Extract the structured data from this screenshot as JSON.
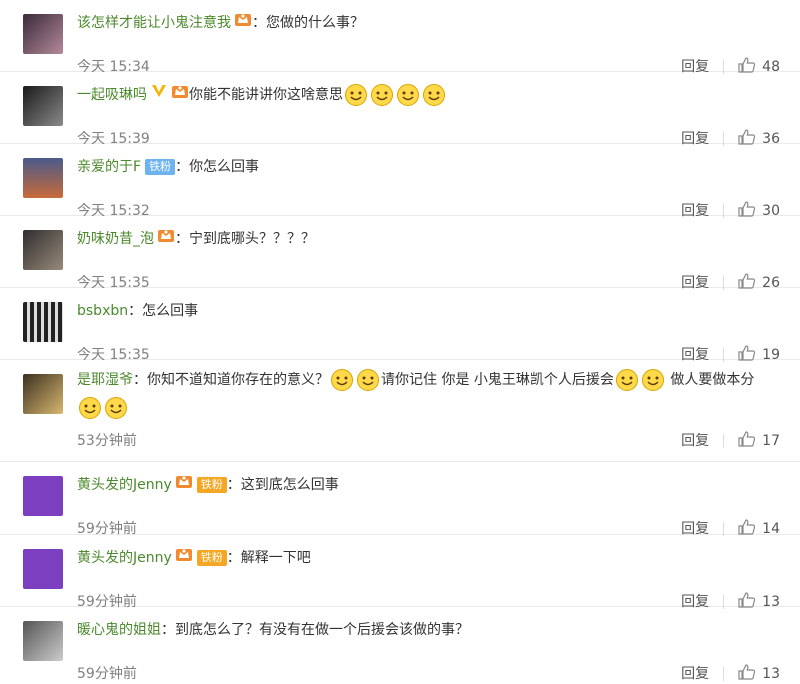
{
  "comments": [
    {
      "user": "该怎样才能让小鬼注意我",
      "badges": [
        "vip"
      ],
      "sep": "：",
      "text": "您做的什么事？",
      "smileys": 0,
      "time": "今天 15:34",
      "reply": "回复",
      "likes": "48"
    },
    {
      "user": "一起吸琳吗",
      "badges": [
        "verified",
        "vip"
      ],
      "sep": "",
      "text": "你能不能讲讲你这啥意思",
      "smileys": 4,
      "time": "今天 15:39",
      "reply": "回复",
      "likes": "36"
    },
    {
      "user": "亲爱的于F",
      "fan": "铁粉",
      "fan_color": "#6db3f0",
      "sep": "：",
      "text": "你怎么回事",
      "smileys": 0,
      "time": "今天 15:32",
      "reply": "回复",
      "likes": "30"
    },
    {
      "user": "奶味奶昔_泡",
      "badges": [
        "vip"
      ],
      "sep": "：",
      "text": "宁到底哪头？？？？",
      "smileys": 0,
      "time": "今天 15:35",
      "reply": "回复",
      "likes": "26"
    },
    {
      "user": "bsbxbn",
      "sep": "：",
      "text": "怎么回事",
      "smileys": 0,
      "time": "今天 15:35",
      "reply": "回复",
      "likes": "19"
    },
    {
      "user": "是耶湿爷",
      "sep": "：",
      "text_parts": [
        "你知不道知道你存在的意义？",
        "请你记住 你是 小鬼王琳凯个人后援会",
        "做人要做本分"
      ],
      "time": "53分钟前",
      "reply": "回复",
      "likes": "17"
    },
    {
      "user": "黄头发的Jenny",
      "fan": "铁粉",
      "fan_color": "#f5a623",
      "sep": "：",
      "text": "这到底怎么回事",
      "smileys": 0,
      "time": "59分钟前",
      "reply": "回复",
      "likes": "14"
    },
    {
      "user": "黄头发的Jenny",
      "fan": "铁粉",
      "fan_color": "#f5a623",
      "sep": "：",
      "text": "解释一下吧",
      "smileys": 0,
      "time": "59分钟前",
      "reply": "回复",
      "likes": "13"
    },
    {
      "user": "暖心鬼的姐姐",
      "sep": "：",
      "text": "到底怎么了？有没有在做一个后援会该做的事？",
      "smileys": 0,
      "time": "59分钟前",
      "reply": "回复",
      "likes": "13"
    }
  ],
  "colors": {
    "username": "#4b8a2c",
    "time": "#808080",
    "divider": "#eaeaea"
  },
  "icons": {
    "like": "thumbs-up-icon",
    "smiley": "smiley-emoji-icon",
    "vip": "vip-crown-icon",
    "verified": "verified-v-icon"
  }
}
